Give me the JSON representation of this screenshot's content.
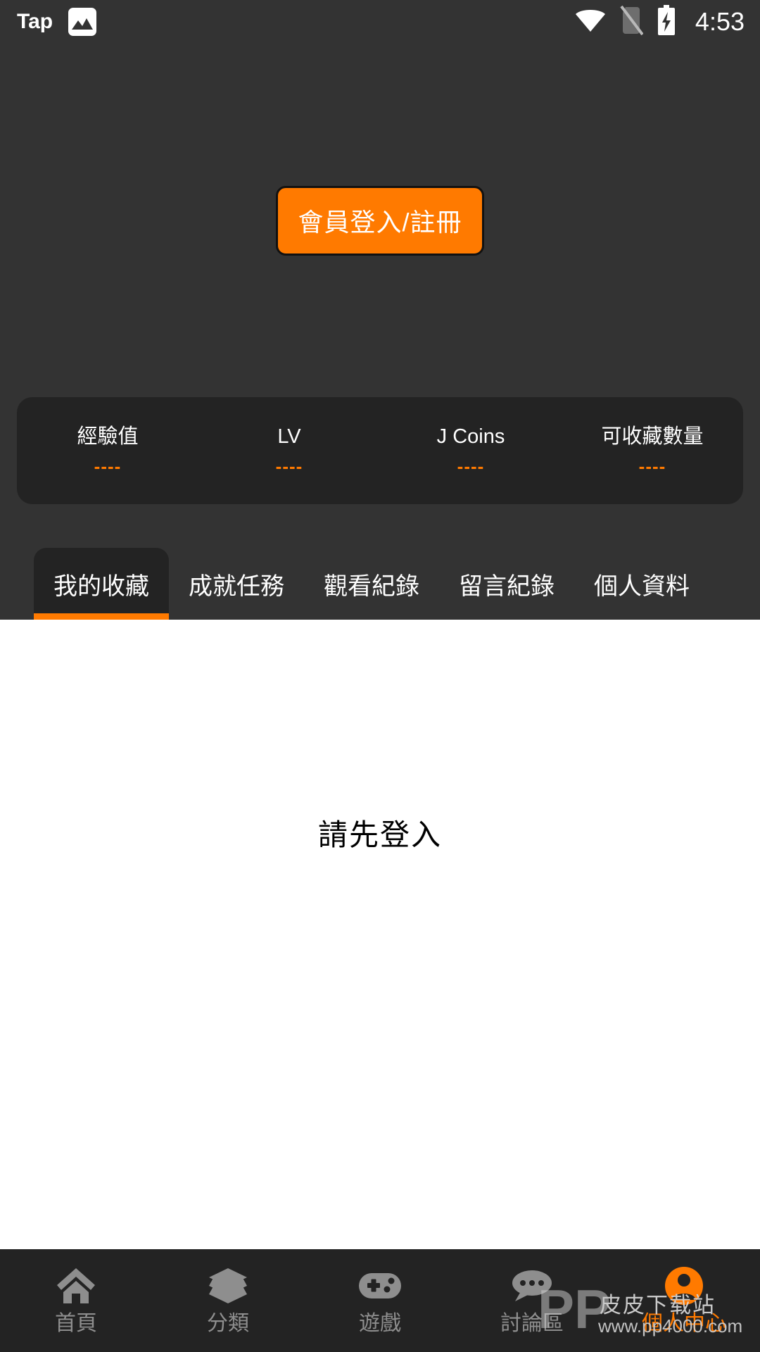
{
  "status_bar": {
    "brand": "Tap",
    "photo_icon": "image-icon",
    "wifi_icon": "wifi-icon",
    "sim_icon": "no-sim-icon",
    "battery_icon": "battery-charging-icon",
    "time": "4:53"
  },
  "hero": {
    "login_button_label": "會員登入/註冊"
  },
  "stats": {
    "items": [
      {
        "label": "經驗值",
        "value": "----"
      },
      {
        "label": "LV",
        "value": "----"
      },
      {
        "label": "J Coins",
        "value": "----"
      },
      {
        "label": "可收藏數量",
        "value": "----"
      }
    ]
  },
  "tabs": [
    {
      "label": "我的收藏",
      "active": true
    },
    {
      "label": "成就任務",
      "active": false
    },
    {
      "label": "觀看紀錄",
      "active": false
    },
    {
      "label": "留言紀錄",
      "active": false
    },
    {
      "label": "個人資料",
      "active": false
    }
  ],
  "content": {
    "empty_message": "請先登入"
  },
  "bottom_nav": [
    {
      "label": "首頁",
      "icon": "home-icon",
      "active": false
    },
    {
      "label": "分類",
      "icon": "layers-icon",
      "active": false
    },
    {
      "label": "遊戲",
      "icon": "gamepad-icon",
      "active": false
    },
    {
      "label": "討論區",
      "icon": "chat-bubble-icon",
      "active": false
    },
    {
      "label": "個人中心",
      "icon": "user-circle-icon",
      "active": true
    }
  ],
  "watermark": {
    "logo": "PP",
    "title": "皮皮下载站",
    "url": "www.pp4000.com"
  },
  "colors": {
    "accent": "#FF7A00",
    "background": "#333333",
    "panel": "#232323",
    "content_background": "#FFFFFF",
    "nav_inactive": "#8E8E8E"
  }
}
